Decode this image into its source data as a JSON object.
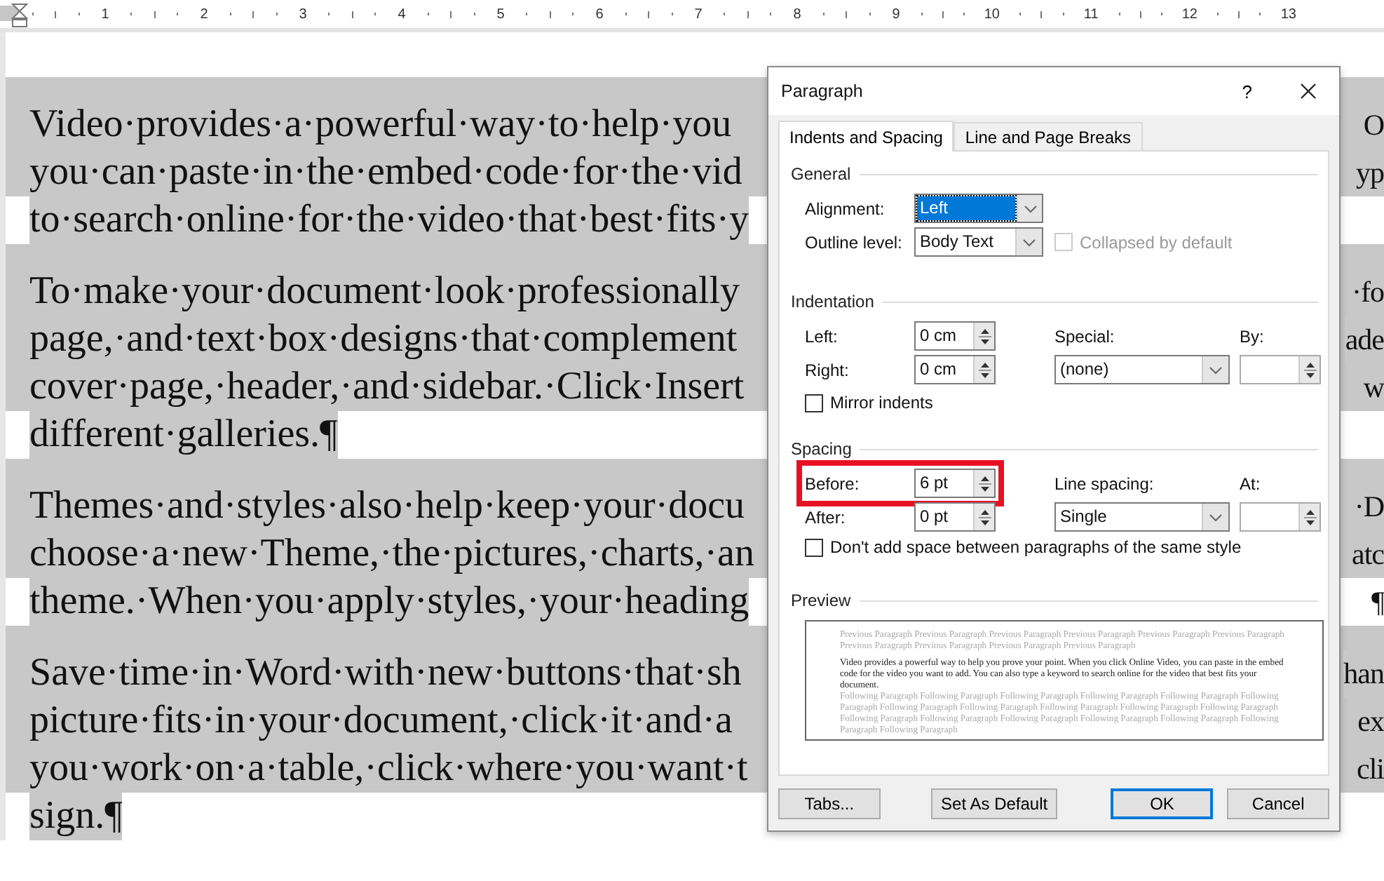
{
  "ruler": {
    "marks": [
      "1",
      "2",
      "3",
      "4",
      "5",
      "6",
      "7",
      "8",
      "9",
      "10",
      "11",
      "12",
      "13"
    ]
  },
  "document": {
    "paragraphs": [
      {
        "lines": [
          {
            "left": "Video·provides·a·powerful·way·to·help·you",
            "right": "O"
          },
          {
            "left": "you·can·paste·in·the·embed·code·for·the·vid",
            "right": "yp"
          },
          {
            "left": "to·search·online·for·the·video·that·best·fits·y"
          }
        ]
      },
      {
        "lines": [
          {
            "left": "To·make·your·document·look·professionally",
            "right": "·fo"
          },
          {
            "left": "page,·and·text·box·designs·that·complement",
            "right": "ade"
          },
          {
            "left": "cover·page,·header,·and·sidebar.·Click·Insert",
            "right": "w"
          },
          {
            "left": "different·galleries.¶"
          }
        ]
      },
      {
        "lines": [
          {
            "left": "Themes·and·styles·also·help·keep·your·docu",
            "right": "·D"
          },
          {
            "left": "choose·a·new·Theme,·the·pictures,·charts,·an",
            "right": "atc"
          },
          {
            "left": "theme.·When·you·apply·styles,·your·heading",
            "right": "¶"
          }
        ]
      },
      {
        "lines": [
          {
            "left": "Save·time·in·Word·with·new·buttons·that·sh",
            "right": "han"
          },
          {
            "left": "picture·fits·in·your·document,·click·it·and·a",
            "right": "ex"
          },
          {
            "left": "you·work·on·a·table,·click·where·you·want·t",
            "right": "cli"
          },
          {
            "left": "sign.¶"
          }
        ]
      }
    ]
  },
  "dialog": {
    "title": "Paragraph",
    "help": "?",
    "tabs": [
      {
        "label": "Indents and Spacing",
        "selected": true
      },
      {
        "label": "Line and Page Breaks",
        "selected": false
      }
    ],
    "general": {
      "heading": "General",
      "alignment": {
        "label": "Alignment:",
        "value": "Left",
        "focused": true
      },
      "outline_level": {
        "label": "Outline level:",
        "value": "Body Text",
        "focused": false
      },
      "collapsed": {
        "label": "Collapsed by default",
        "checked": false,
        "disabled": true
      }
    },
    "indentation": {
      "heading": "Indentation",
      "left": {
        "label": "Left:",
        "value": "0 cm"
      },
      "right": {
        "label": "Right:",
        "value": "0 cm"
      },
      "special": {
        "label": "Special:",
        "value": "(none)"
      },
      "by": {
        "label": "By:"
      },
      "mirror": {
        "label": "Mirror indents",
        "checked": false,
        "disabled": false
      }
    },
    "spacing": {
      "heading": "Spacing",
      "before": {
        "label": "Before:",
        "value": "6 pt",
        "highlighted": true
      },
      "after": {
        "label": "After:",
        "value": "0 pt",
        "highlighted": false
      },
      "line_spacing": {
        "label": "Line spacing:",
        "value": "Single"
      },
      "at": {
        "label": "At:"
      },
      "dont_add": {
        "label": "Don't add space between paragraphs of the same style",
        "checked": false,
        "disabled": false
      }
    },
    "preview": {
      "heading": "Preview",
      "previous": "Previous Paragraph Previous Paragraph Previous Paragraph Previous Paragraph Previous Paragraph Previous Paragraph Previous Paragraph Previous Paragraph Previous Paragraph Previous Paragraph",
      "current": "Video provides a powerful way to help you prove your point. When you click Online Video, you can paste in the embed code for the video you want to add. You can also type a keyword to search online for the video that best fits your document.",
      "following": "Following Paragraph Following Paragraph Following Paragraph Following Paragraph Following Paragraph Following Paragraph Following Paragraph Following Paragraph Following Paragraph Following Paragraph Following Paragraph Following Paragraph Following Paragraph Following Paragraph Following Paragraph Following Paragraph Following Paragraph Following Paragraph"
    },
    "buttons": [
      {
        "label": "Tabs...",
        "default": false
      },
      {
        "label": "Set As Default",
        "default": false
      },
      {
        "label": "OK",
        "default": true
      },
      {
        "label": "Cancel",
        "default": false
      }
    ]
  }
}
